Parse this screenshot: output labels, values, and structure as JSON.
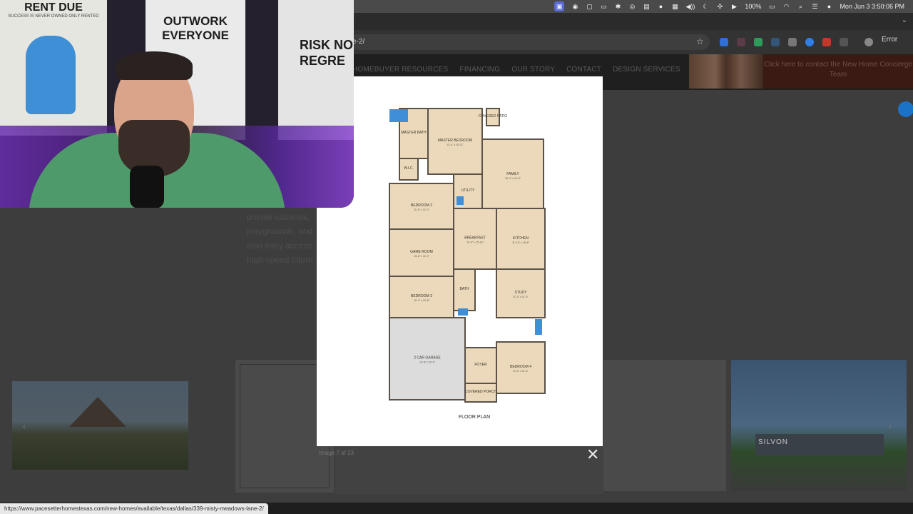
{
  "menubar": {
    "battery": "100%",
    "datetime": "Mon Jun 3  3:50:06 PM"
  },
  "browser": {
    "url_fragment": "e-2/",
    "error_label": "Error",
    "tab_chevron": "⌄"
  },
  "site": {
    "nav": [
      "HOMEBUYER RESOURCES",
      "FINANCING",
      "OUR STORY",
      "CONTACT",
      "DESIGN SERVICES"
    ],
    "concierge": "Click here to contact the New Home Concierge Team",
    "body_lines": [
      "private cabanas,",
      "playgrounds, and",
      "also easy access",
      "high-speed intern"
    ],
    "entrance_sign": "SILVON"
  },
  "lightbox": {
    "counter": "Image 7 of 23",
    "close": "✕",
    "next_chevron": "›"
  },
  "floorplan": {
    "caption": "FLOOR PLAN",
    "rooms": [
      {
        "name": "MASTER BEDROOM",
        "dims": "13'-4\" x 15'-11\""
      },
      {
        "name": "MASTER BATH",
        "dims": ""
      },
      {
        "name": "W.I.C.",
        "dims": ""
      },
      {
        "name": "FAMILY",
        "dims": "15'-4\" x 19'-3\""
      },
      {
        "name": "UTILITY",
        "dims": ""
      },
      {
        "name": "BEDROOM 2",
        "dims": "11'-0\" x 11'-0\""
      },
      {
        "name": "BREAKFAST",
        "dims": "10'-4\" x 15'-10\""
      },
      {
        "name": "KITCHEN",
        "dims": "11'-10\" x 15'-8\""
      },
      {
        "name": "GAME ROOM",
        "dims": "15'-8\" x 11'-0\""
      },
      {
        "name": "STUDY",
        "dims": "11'-0\" x 11'-0\""
      },
      {
        "name": "BEDROOM 3",
        "dims": "12'-4\" x 10'-8\""
      },
      {
        "name": "BATH",
        "dims": ""
      },
      {
        "name": "2 CAR GARAGE",
        "dims": "19'-8\" x 20'-0\""
      },
      {
        "name": "FOYER",
        "dims": ""
      },
      {
        "name": "BEDROOM 4",
        "dims": "11'-0\" x 11'-0\""
      },
      {
        "name": "COVERED PORCH",
        "dims": ""
      },
      {
        "name": "COVERED PATIO",
        "dims": ""
      }
    ]
  },
  "webcam": {
    "posters": [
      {
        "title": "RENT DUE",
        "sub": "SUCCESS IS NEVER OWNED ONLY RENTED"
      },
      {
        "title": "OUTWORK EVERYONE",
        "sub": ""
      },
      {
        "title": "RISK NO REGRE",
        "sub": ""
      }
    ]
  },
  "statusbar": {
    "url": "https://www.pacesetterhomestexas.com/new-homes/available/texas/dallas/339-misty-meadows-lane-2/"
  },
  "colors": {
    "plan_fill": "#ecd9bb",
    "plan_wall": "#5a5248",
    "garage_fill": "#dcdcdc",
    "tile_blue": "#3f8ed6",
    "nav_text": "#5a5a5a"
  }
}
